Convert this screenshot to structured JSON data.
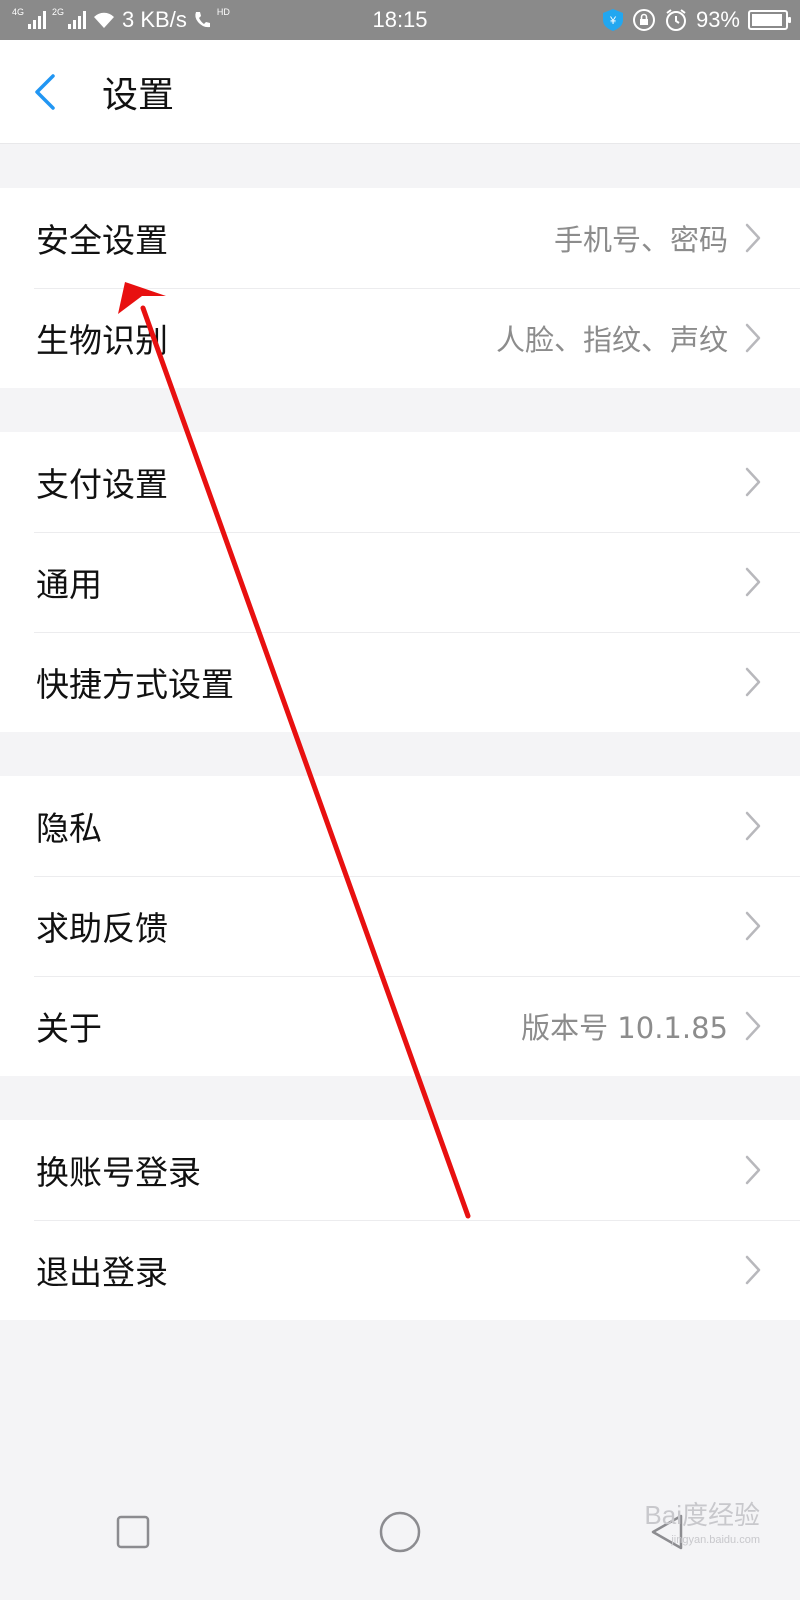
{
  "status_bar": {
    "network_a": "4G",
    "network_b": "2G",
    "speed": "3 KB/s",
    "hd": "HD",
    "time": "18:15",
    "battery": "93%",
    "battery_level": 0.93
  },
  "header": {
    "title": "设置"
  },
  "groups": [
    {
      "items": [
        {
          "label": "安全设置",
          "value": "手机号、密码"
        },
        {
          "label": "生物识别",
          "value": "人脸、指纹、声纹"
        }
      ]
    },
    {
      "items": [
        {
          "label": "支付设置",
          "value": ""
        },
        {
          "label": "通用",
          "value": ""
        },
        {
          "label": "快捷方式设置",
          "value": ""
        }
      ]
    },
    {
      "items": [
        {
          "label": "隐私",
          "value": ""
        },
        {
          "label": "求助反馈",
          "value": ""
        },
        {
          "label": "关于",
          "value": "版本号 10.1.85"
        }
      ]
    },
    {
      "items": [
        {
          "label": "换账号登录",
          "value": ""
        },
        {
          "label": "退出登录",
          "value": ""
        }
      ]
    }
  ],
  "watermark": {
    "brand": "Bai度经验",
    "url": "jingyan.baidu.com"
  },
  "colors": {
    "accent": "#2196F3",
    "annotation": "#e81010"
  }
}
